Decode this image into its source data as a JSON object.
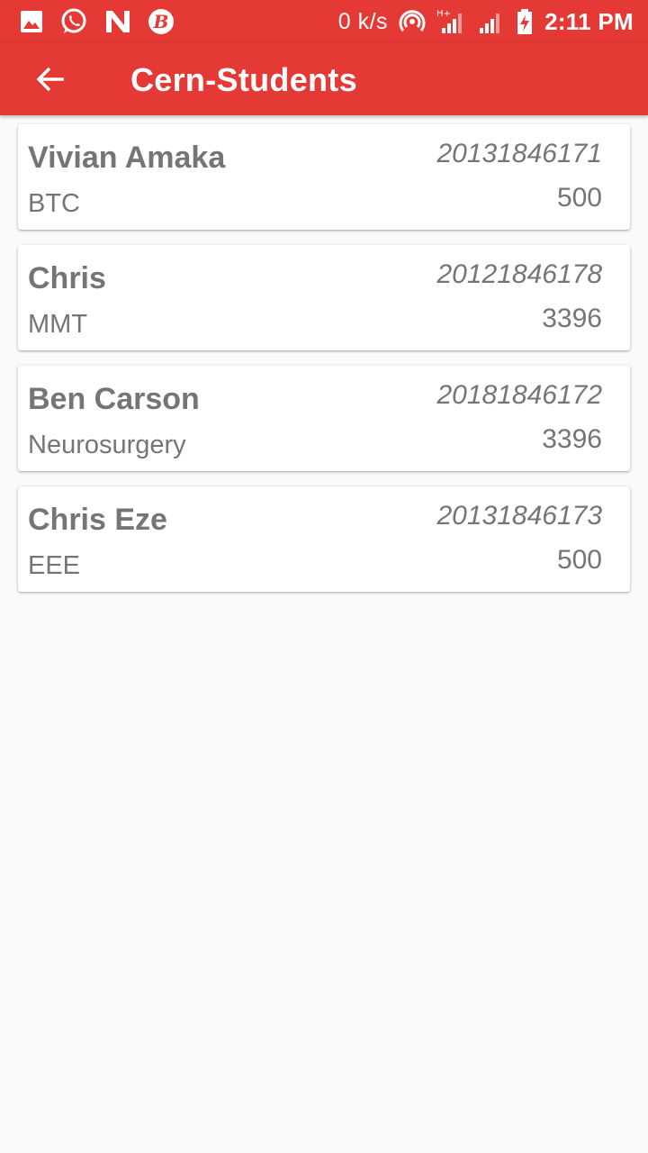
{
  "status_bar": {
    "left_icons": [
      "gallery-icon",
      "whatsapp-icon",
      "n-app-icon",
      "b-app-icon"
    ],
    "speed": "0 k/s",
    "network_type": "H+",
    "time": "2:11 PM"
  },
  "app_bar": {
    "title": "Cern-Students",
    "back_icon": "arrow-back-icon"
  },
  "colors": {
    "accent": "#e53935",
    "background": "#fafafa",
    "card": "#ffffff",
    "text": "#757575"
  },
  "students": [
    {
      "name": "Vivian Amaka",
      "dept": "BTC",
      "id": "20131846171",
      "amount": "500"
    },
    {
      "name": "Chris",
      "dept": "MMT",
      "id": "20121846178",
      "amount": "3396"
    },
    {
      "name": "Ben Carson",
      "dept": "Neurosurgery",
      "id": "20181846172",
      "amount": "3396"
    },
    {
      "name": "Chris Eze",
      "dept": "EEE",
      "id": "20131846173",
      "amount": "500"
    }
  ]
}
